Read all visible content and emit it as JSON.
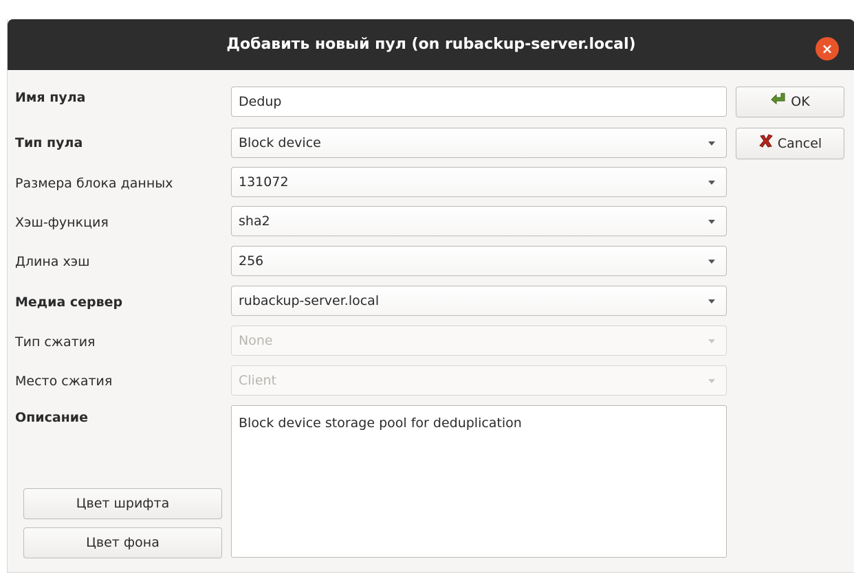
{
  "window": {
    "title": "Добавить новый пул (on rubackup-server.local)"
  },
  "form": {
    "pool_name_label": "Имя пула",
    "pool_name_value": "Dedup",
    "pool_type_label": "Тип пула",
    "pool_type_value": "Block device",
    "block_size_label": "Размера блока данных",
    "block_size_value": "131072",
    "hash_function_label": "Хэш-функция",
    "hash_function_value": "sha2",
    "hash_length_label": "Длина хэш",
    "hash_length_value": "256",
    "media_server_label": "Медиа сервер",
    "media_server_value": "rubackup-server.local",
    "compression_type_label": "Тип сжатия",
    "compression_type_value": "None",
    "compression_place_label": "Место сжатия",
    "compression_place_value": "Client",
    "description_label": "Описание",
    "description_value": "Block device storage pool for deduplication"
  },
  "buttons": {
    "ok": "OK",
    "cancel": "Cancel",
    "font_color": "Цвет шрифта",
    "background_color": "Цвет фона"
  },
  "icons": {
    "ok": "green-arrow-icon",
    "cancel": "red-x-icon",
    "close": "close-icon"
  },
  "colors": {
    "titlebar": "#2d2d2d",
    "close": "#e9552b",
    "ok_icon": "#5e8f2a",
    "cancel_icon": "#b3261e"
  }
}
